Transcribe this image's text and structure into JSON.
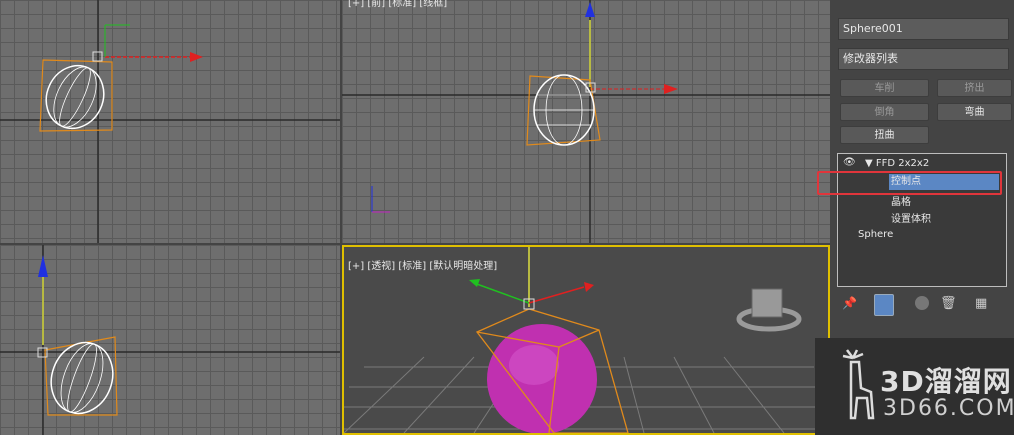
{
  "viewports": {
    "front_label": "[+] [前] [标准] [线框]",
    "persp_label": "[+] [透视] [标准] [默认明暗处理]"
  },
  "panel": {
    "object_name": "Sphere001",
    "modifier_list": "修改器列表",
    "buttons": [
      "车削",
      "挤出",
      "倒角",
      "弯曲",
      "扭曲"
    ],
    "stack": {
      "ffd": "FFD 2x2x2",
      "control_points": "控制点",
      "lattice": "晶格",
      "set_volume": "设置体积",
      "base": "Sphere"
    }
  },
  "watermark": {
    "brand": "3D溜溜网",
    "domain": "3D66.COM"
  },
  "colors": {
    "selection_highlight": "#5b87c4",
    "callout_red": "#e0353b",
    "ffd_lattice": "#e08a1c",
    "sphere_magenta": "#c030b0",
    "axis_x": "#e02020",
    "axis_y": "#20c020",
    "axis_z": "#2030e0"
  }
}
